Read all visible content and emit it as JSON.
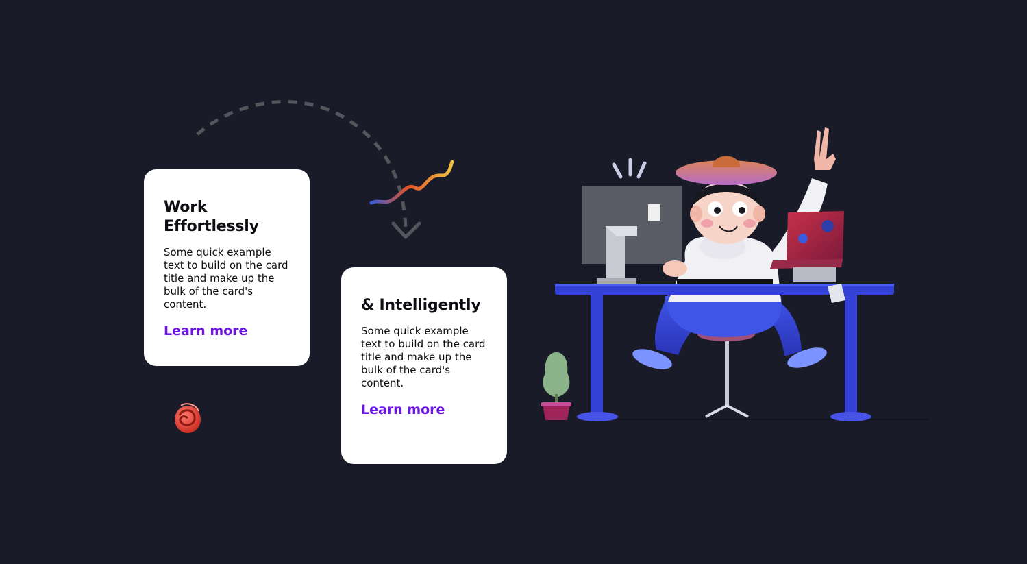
{
  "cards": [
    {
      "title": "Work Effortlessly",
      "text": "Some quick example text to build on the card title and make up the bulk of the card's content.",
      "link": "Learn more"
    },
    {
      "title": "& Intelligently",
      "text": "Some quick example text to build on the card title and make up the bulk of the card's content.",
      "link": "Learn more"
    }
  ],
  "colors": {
    "background": "#1a1b28",
    "card": "#ffffff",
    "link": "#6c13e6",
    "desk": "#3341d6"
  },
  "icons": [
    "dashed-arrow-icon",
    "squiggle-icon",
    "spiral-icon",
    "person-at-desk-illustration"
  ]
}
